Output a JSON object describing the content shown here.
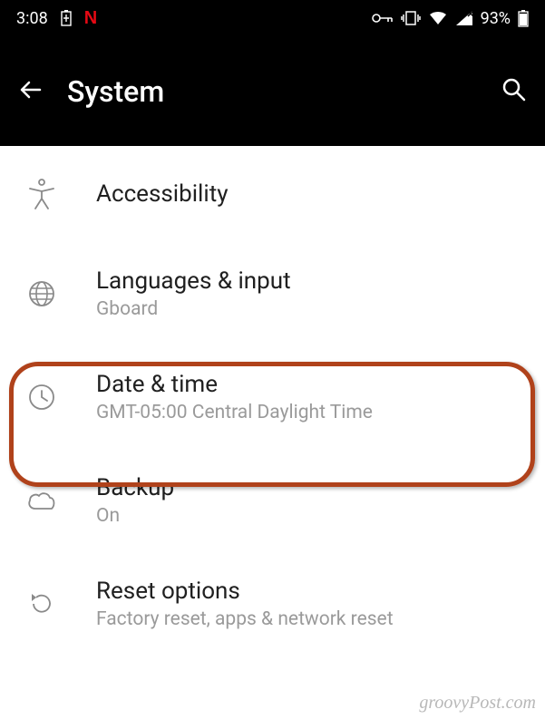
{
  "statusbar": {
    "time": "3:08",
    "battery_pct": "93%"
  },
  "header": {
    "title": "System"
  },
  "items": [
    {
      "title": "Accessibility",
      "subtitle": ""
    },
    {
      "title": "Languages & input",
      "subtitle": "Gboard"
    },
    {
      "title": "Date & time",
      "subtitle": "GMT-05:00 Central Daylight Time"
    },
    {
      "title": "Backup",
      "subtitle": "On"
    },
    {
      "title": "Reset options",
      "subtitle": "Factory reset, apps & network reset"
    }
  ],
  "watermark": "groovyPost.com"
}
